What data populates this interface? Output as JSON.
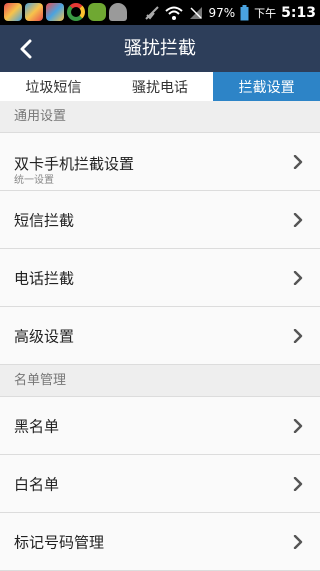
{
  "status_bar": {
    "battery": "97%",
    "ampm": "下午",
    "time": "5:13"
  },
  "header": {
    "title": "骚扰拦截"
  },
  "tabs": [
    {
      "label": "垃圾短信",
      "active": false
    },
    {
      "label": "骚扰电话",
      "active": false
    },
    {
      "label": "拦截设置",
      "active": true
    }
  ],
  "sections": {
    "general": {
      "header": "通用设置",
      "items": [
        {
          "label": "双卡手机拦截设置",
          "sub": "统一设置"
        },
        {
          "label": "短信拦截"
        },
        {
          "label": "电话拦截"
        },
        {
          "label": "高级设置"
        }
      ]
    },
    "list_mgmt": {
      "header": "名单管理",
      "items": [
        {
          "label": "黑名单"
        },
        {
          "label": "白名单"
        },
        {
          "label": "标记号码管理"
        }
      ]
    }
  },
  "colors": {
    "title_bar": "#2d3e5a",
    "active_tab": "#2d84c7"
  }
}
